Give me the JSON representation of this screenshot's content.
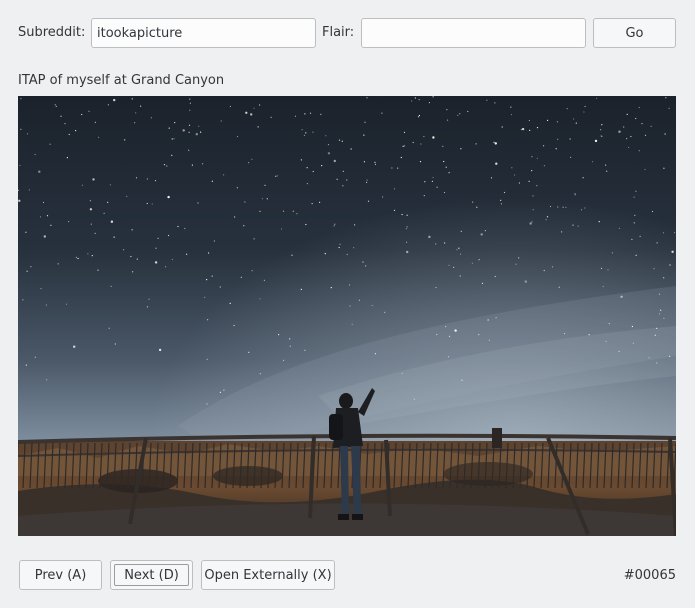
{
  "toolbar": {
    "subreddit_label": "Subreddit:",
    "subreddit_value": "itookapicture",
    "flair_label": "Flair:",
    "flair_value": "",
    "go_label": "Go"
  },
  "post": {
    "title": "ITAP of myself at Grand Canyon"
  },
  "footer": {
    "prev_label": "Prev (A)",
    "next_label": "Next (D)",
    "open_label": "Open Externally (X)",
    "counter": "#00065"
  },
  "colors": {
    "window_bg": "#eff0f1",
    "sky_top": "#1e2530",
    "sky_horizon": "#8a98a8",
    "canyon": "#5a3a22"
  }
}
